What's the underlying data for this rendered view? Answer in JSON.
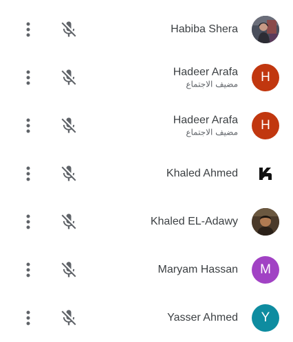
{
  "participants": [
    {
      "name": "Habiba Shera",
      "role": "",
      "avatar": {
        "type": "photo",
        "description": "photo"
      }
    },
    {
      "name": "Hadeer Arafa",
      "role": "مضيف الاجتماع",
      "avatar": {
        "type": "initial",
        "initial": "H",
        "color": "#c1370f"
      }
    },
    {
      "name": "Hadeer Arafa",
      "role": "مضيف الاجتماع",
      "avatar": {
        "type": "initial",
        "initial": "H",
        "color": "#c1370f"
      }
    },
    {
      "name": "Khaled Ahmed",
      "role": "",
      "avatar": {
        "type": "logo",
        "initial": "K"
      }
    },
    {
      "name": "Khaled EL-Adawy",
      "role": "",
      "avatar": {
        "type": "photo"
      }
    },
    {
      "name": "Maryam Hassan",
      "role": "",
      "avatar": {
        "type": "initial",
        "initial": "M",
        "color": "#a142c4"
      }
    },
    {
      "name": "Yasser Ahmed",
      "role": "",
      "avatar": {
        "type": "initial",
        "initial": "Y",
        "color": "#0e8ca0"
      }
    }
  ],
  "icons": {
    "menu": "more-vert-icon",
    "mic": "mic-off-icon"
  },
  "colors": {
    "icon": "#5f6368",
    "text": "#3c4043"
  }
}
